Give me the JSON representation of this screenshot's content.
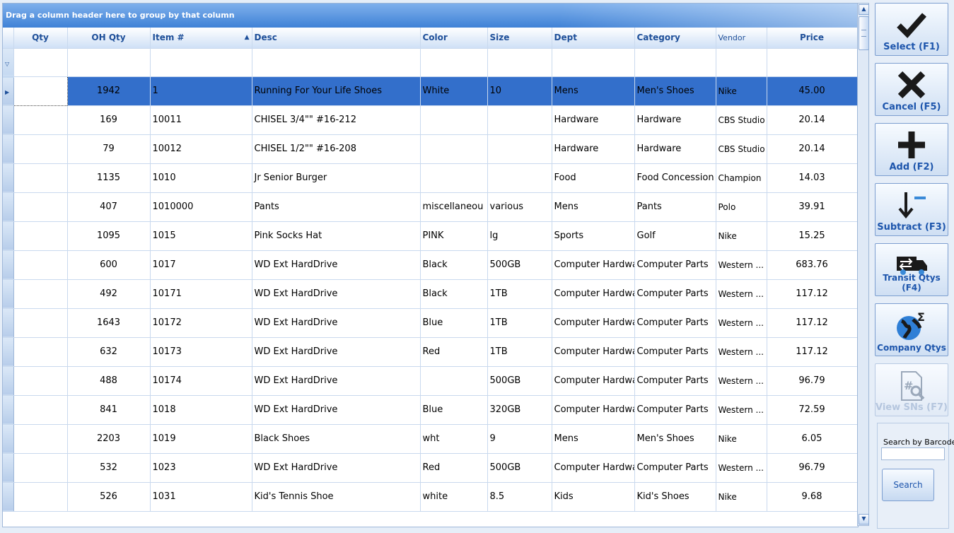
{
  "grid": {
    "group_panel_text": "Drag a column header here to group by that column",
    "filter_icon": "filter-icon",
    "columns": [
      "Qty",
      "OH Qty",
      "Item #",
      "Desc",
      "Color",
      "Size",
      "Dept",
      "Category",
      "Vendor",
      "Price"
    ],
    "rows": [
      {
        "qty": "",
        "oh_qty": "1942",
        "item": "1",
        "desc": "Running For Your Life Shoes",
        "color": "White",
        "size": "10",
        "dept": "Mens",
        "category": "Men's Shoes",
        "vendor": "Nike",
        "price": "45.00"
      },
      {
        "qty": "",
        "oh_qty": "169",
        "item": "10011",
        "desc": "CHISEL 3/4\"\" #16-212",
        "color": "",
        "size": "",
        "dept": "Hardware",
        "category": "Hardware",
        "vendor": "CBS Studio",
        "price": "20.14"
      },
      {
        "qty": "",
        "oh_qty": "79",
        "item": "10012",
        "desc": "CHISEL 1/2\"\" #16-208",
        "color": "",
        "size": "",
        "dept": "Hardware",
        "category": "Hardware",
        "vendor": "CBS Studio",
        "price": "20.14"
      },
      {
        "qty": "",
        "oh_qty": "1135",
        "item": "1010",
        "desc": "Jr Senior Burger",
        "color": "",
        "size": "",
        "dept": "Food",
        "category": "Food Concession",
        "vendor": "Champion",
        "price": "14.03"
      },
      {
        "qty": "",
        "oh_qty": "407",
        "item": "1010000",
        "desc": "Pants",
        "color": "miscellaneou",
        "size": "various",
        "dept": "Mens",
        "category": "Pants",
        "vendor": "Polo",
        "price": "39.91"
      },
      {
        "qty": "",
        "oh_qty": "1095",
        "item": "1015",
        "desc": "Pink Socks Hat",
        "color": "PINK",
        "size": "lg",
        "dept": "Sports",
        "category": "Golf",
        "vendor": "Nike",
        "price": "15.25"
      },
      {
        "qty": "",
        "oh_qty": "600",
        "item": "1017",
        "desc": "WD Ext HardDrive",
        "color": "Black",
        "size": "500GB",
        "dept": "Computer Hardwa",
        "category": "Computer Parts",
        "vendor": "Western ...",
        "price": "683.76"
      },
      {
        "qty": "",
        "oh_qty": "492",
        "item": "10171",
        "desc": "WD Ext HardDrive",
        "color": "Black",
        "size": "1TB",
        "dept": "Computer Hardwa",
        "category": "Computer Parts",
        "vendor": "Western ...",
        "price": "117.12"
      },
      {
        "qty": "",
        "oh_qty": "1643",
        "item": "10172",
        "desc": "WD Ext HardDrive",
        "color": "Blue",
        "size": "1TB",
        "dept": "Computer Hardwa",
        "category": "Computer Parts",
        "vendor": "Western ...",
        "price": "117.12"
      },
      {
        "qty": "",
        "oh_qty": "632",
        "item": "10173",
        "desc": "WD Ext HardDrive",
        "color": "Red",
        "size": "1TB",
        "dept": "Computer Hardwa",
        "category": "Computer Parts",
        "vendor": "Western ...",
        "price": "117.12"
      },
      {
        "qty": "",
        "oh_qty": "488",
        "item": "10174",
        "desc": "WD Ext HardDrive",
        "color": "",
        "size": "500GB",
        "dept": "Computer Hardwa",
        "category": "Computer Parts",
        "vendor": "Western ...",
        "price": "96.79"
      },
      {
        "qty": "",
        "oh_qty": "841",
        "item": "1018",
        "desc": "WD Ext HardDrive",
        "color": "Blue",
        "size": "320GB",
        "dept": "Computer Hardwa",
        "category": "Computer Parts",
        "vendor": "Western ...",
        "price": "72.59"
      },
      {
        "qty": "",
        "oh_qty": "2203",
        "item": "1019",
        "desc": "Black Shoes",
        "color": "wht",
        "size": "9",
        "dept": "Mens",
        "category": "Men's Shoes",
        "vendor": "Nike",
        "price": "6.05"
      },
      {
        "qty": "",
        "oh_qty": "532",
        "item": "1023",
        "desc": "WD Ext HardDrive",
        "color": "Red",
        "size": "500GB",
        "dept": "Computer Hardwa",
        "category": "Computer Parts",
        "vendor": "Western ...",
        "price": "96.79"
      },
      {
        "qty": "",
        "oh_qty": "526",
        "item": "1031",
        "desc": "Kid's Tennis Shoe",
        "color": "white",
        "size": "8.5",
        "dept": "Kids",
        "category": "Kid's Shoes",
        "vendor": "Nike",
        "price": "9.68"
      }
    ]
  },
  "actions": [
    {
      "label": "Select (F1)",
      "icon": "checkmark-icon",
      "enabled": true
    },
    {
      "label": "Cancel (F5)",
      "icon": "x-icon",
      "enabled": true
    },
    {
      "label": "Add (F2)",
      "icon": "plus-icon",
      "enabled": true
    },
    {
      "label": "Subtract (F3)",
      "icon": "subtract-arrow-icon",
      "enabled": true
    },
    {
      "label": "Transit Qtys (F4)",
      "icon": "truck-icon",
      "enabled": true
    },
    {
      "label": "Company Qtys",
      "icon": "globe-sigma-icon",
      "enabled": true
    },
    {
      "label": "View SNs (F7)",
      "icon": "document-search-icon",
      "enabled": false
    }
  ],
  "search": {
    "label": "Search by Barcode",
    "value": "",
    "button": "Search"
  },
  "colors": {
    "selected_row": "#336fcb",
    "header_text": "#1e4f99",
    "button_text": "#1d55ac"
  }
}
